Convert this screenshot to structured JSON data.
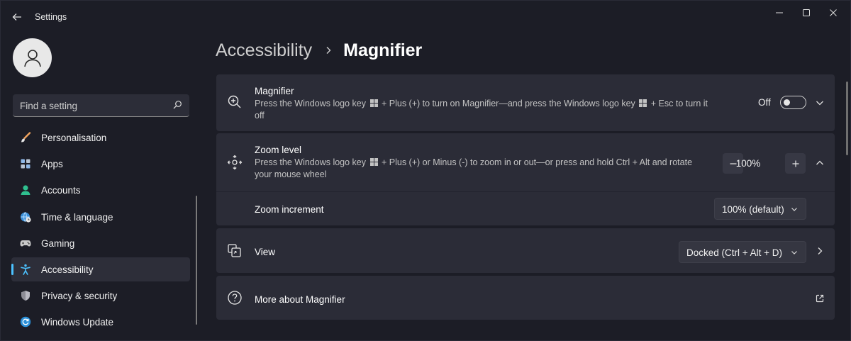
{
  "window": {
    "title": "Settings",
    "controls": [
      "minimize",
      "maximize",
      "close"
    ]
  },
  "sidebar": {
    "search": {
      "placeholder": "Find a setting"
    },
    "items": [
      {
        "label": "Personalisation",
        "icon": "paintbrush-icon",
        "active": false
      },
      {
        "label": "Apps",
        "icon": "apps-icon",
        "active": false
      },
      {
        "label": "Accounts",
        "icon": "accounts-icon",
        "active": false
      },
      {
        "label": "Time & language",
        "icon": "globe-clock-icon",
        "active": false
      },
      {
        "label": "Gaming",
        "icon": "gamepad-icon",
        "active": false
      },
      {
        "label": "Accessibility",
        "icon": "accessibility-icon",
        "active": true
      },
      {
        "label": "Privacy & security",
        "icon": "shield-icon",
        "active": false
      },
      {
        "label": "Windows Update",
        "icon": "update-icon",
        "active": false
      }
    ]
  },
  "breadcrumb": {
    "parent": "Accessibility",
    "current": "Magnifier"
  },
  "magnifier": {
    "title": "Magnifier",
    "desc_part1": "Press the Windows logo key",
    "desc_part2": "+ Plus (+) to turn on Magnifier—and press the Windows logo key",
    "desc_part3": "+ Esc to turn it off",
    "toggle_label": "Off",
    "toggle_on": false
  },
  "zoom": {
    "title": "Zoom level",
    "desc_part1": "Press the Windows logo key",
    "desc_part2": "+ Plus (+) or Minus (-) to zoom in or out—or press and hold Ctrl + Alt and rotate your mouse wheel",
    "value": "100%",
    "increment_label": "Zoom increment",
    "increment_value": "100% (default)"
  },
  "view": {
    "title": "View",
    "value": "Docked (Ctrl + Alt + D)"
  },
  "more": {
    "title": "More about Magnifier"
  },
  "colors": {
    "background": "#1c1d26",
    "card": "#2b2c37",
    "accent": "#4cc2ff"
  }
}
